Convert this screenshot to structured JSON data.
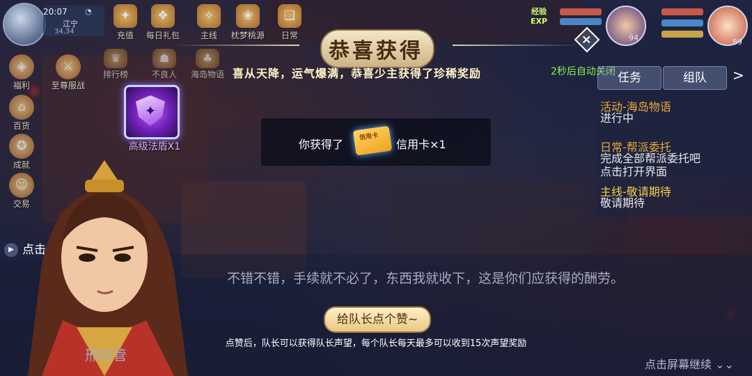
{
  "status": {
    "time": "20:07",
    "map": "江宁",
    "coords": "34,34"
  },
  "top_menu": [
    "充值",
    "每日礼包",
    "主线",
    "枕梦桃源",
    "日常"
  ],
  "row2_menu": [
    "排行榜",
    "不良人",
    "海岛物语"
  ],
  "left_menu": [
    "福利",
    "至尊服战",
    "百货",
    "成就",
    "交易"
  ],
  "party": {
    "exp_label": "经验\nEXP",
    "member1_level": "94",
    "member2_level": "89"
  },
  "reward": {
    "title": "恭喜获得",
    "subtitle": "喜从天降，运气爆满，恭喜少主获得了珍稀奖励",
    "auto_close": "2秒后自动关闭",
    "item_label": "高级法盾X1",
    "gain_prefix": "你获得了",
    "card_text": "信用卡",
    "gain_item": "信用卡×1"
  },
  "quest_panel": {
    "tabs": [
      "任务",
      "组队"
    ],
    "quests": [
      {
        "title": "活动-海岛物语",
        "desc": "进行中",
        "color": "#e8a83c"
      },
      {
        "title": "日常-帮派委托",
        "desc": "完成全部帮派委托吧\n点击打开界面",
        "color": "#e8a83c"
      },
      {
        "title": "主线-敬请期待",
        "desc": "敬请期待",
        "color": "#f2d24a"
      }
    ]
  },
  "dialogue": {
    "collapse_label": "点击收",
    "text": "不错不错，手续就不必了，东西我就收下，这是你们应获得的酬劳。",
    "speaker": "邢总管",
    "like_button": "给队长点个赞~",
    "like_desc": "点赞后，队长可以获得队长声望，每个队长每天最多可以收到15次声望奖励",
    "continue_hint": "点击屏幕继续 ⌄⌄"
  }
}
